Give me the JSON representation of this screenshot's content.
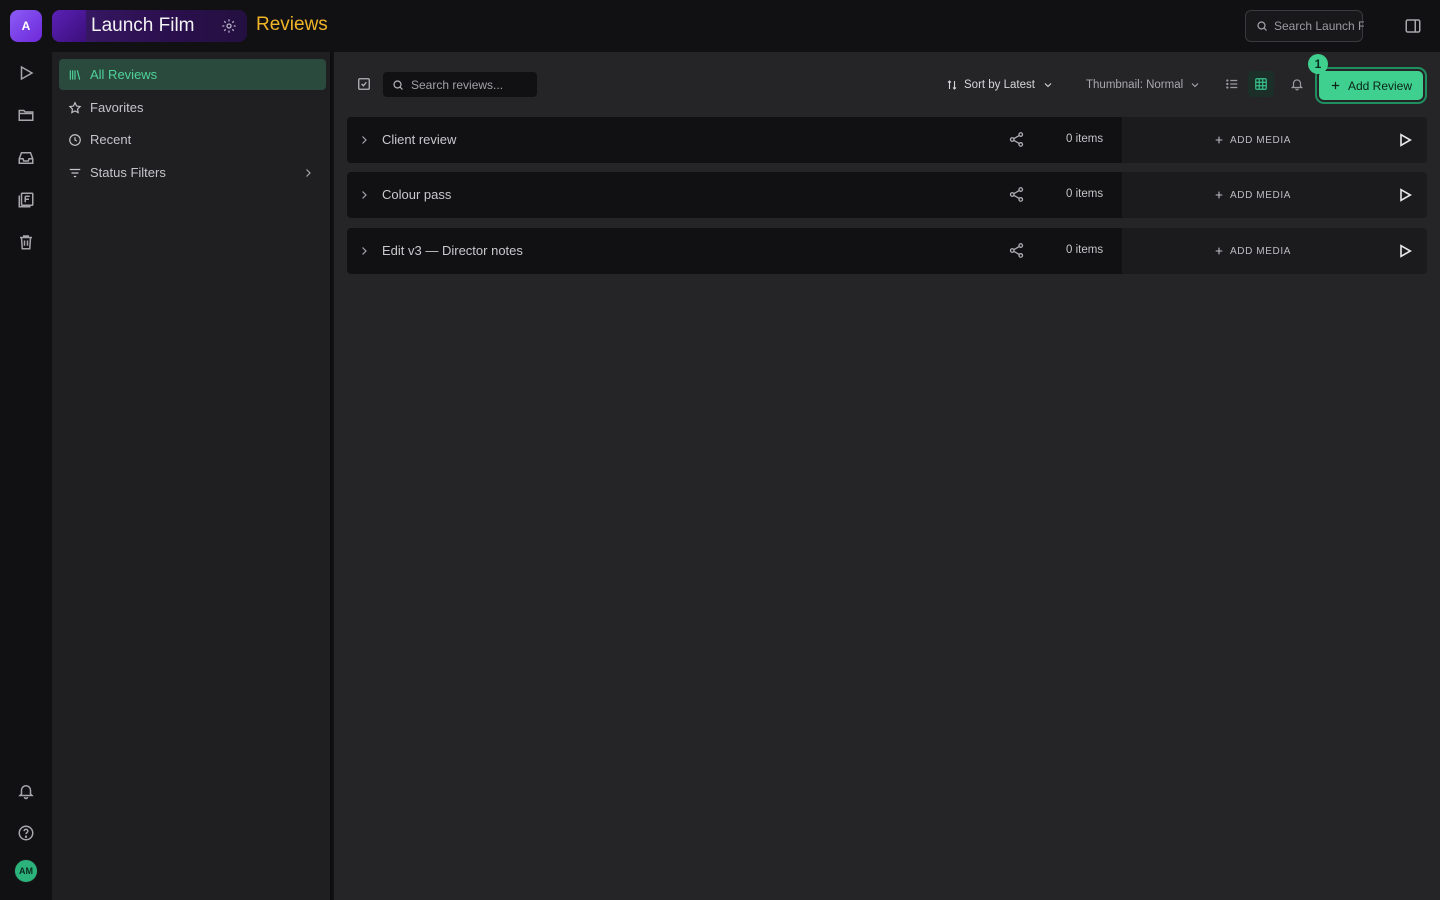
{
  "topbar": {
    "workspace_initial": "A",
    "project_name": "Launch Film",
    "page_title": "Reviews",
    "search_placeholder": "Search Launch Film"
  },
  "rail": {
    "icons": [
      "play-icon",
      "folder-icon",
      "inbox-icon",
      "library-icon",
      "trash-icon"
    ],
    "bottom_icons": [
      "bell-icon",
      "help-icon"
    ],
    "user_initials": "AM"
  },
  "sidebar": {
    "items": [
      {
        "label": "All Reviews",
        "icon": "library-icon",
        "active": true
      },
      {
        "label": "Favorites",
        "icon": "star-icon"
      },
      {
        "label": "Recent",
        "icon": "clock-icon"
      },
      {
        "label": "Status Filters",
        "icon": "filter-icon",
        "has_chevron": true
      }
    ]
  },
  "toolbar": {
    "search_placeholder": "Search reviews...",
    "sort_label": "Sort by Latest",
    "thumbnail_label": "Thumbnail: Normal",
    "add_review_label": "Add Review",
    "step_badge": "1"
  },
  "reviews": [
    {
      "name": "Client review",
      "count": "0 items",
      "add_media_label": "ADD MEDIA"
    },
    {
      "name": "Colour pass",
      "count": "0 items",
      "add_media_label": "ADD MEDIA"
    },
    {
      "name": "Edit v3 — Director notes",
      "count": "0 items",
      "add_media_label": "ADD MEDIA"
    }
  ],
  "colors": {
    "accent": "#3fcf8e",
    "title": "#f0b429",
    "workspace": "#7c3aed"
  }
}
